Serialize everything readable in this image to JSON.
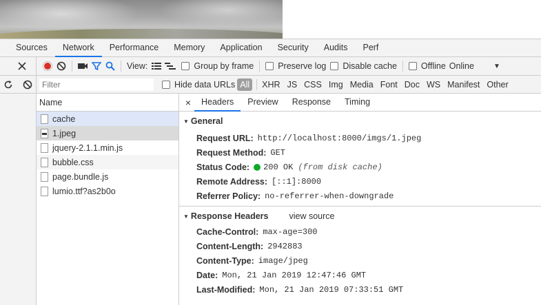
{
  "tabs": [
    {
      "label": "Sources"
    },
    {
      "label": "Network"
    },
    {
      "label": "Performance"
    },
    {
      "label": "Memory"
    },
    {
      "label": "Application"
    },
    {
      "label": "Security"
    },
    {
      "label": "Audits"
    },
    {
      "label": "Perf"
    }
  ],
  "toolbar": {
    "view_label": "View:",
    "group_by_frame": "Group by frame",
    "preserve_log": "Preserve log",
    "disable_cache": "Disable cache",
    "offline": "Offline",
    "throttle_value": "Online"
  },
  "filter": {
    "placeholder": "Filter",
    "hide_data_urls": "Hide data URLs",
    "types": [
      "All",
      "XHR",
      "JS",
      "CSS",
      "Img",
      "Media",
      "Font",
      "Doc",
      "WS",
      "Manifest",
      "Other"
    ]
  },
  "requests": {
    "column_name": "Name",
    "items": [
      {
        "name": "cache"
      },
      {
        "name": "1.jpeg"
      },
      {
        "name": "jquery-2.1.1.min.js"
      },
      {
        "name": "bubble.css"
      },
      {
        "name": "page.bundle.js"
      },
      {
        "name": "lumio.ttf?as2b0o"
      }
    ]
  },
  "details": {
    "tabs": [
      "Headers",
      "Preview",
      "Response",
      "Timing"
    ],
    "general": {
      "title": "General",
      "request_url_label": "Request URL:",
      "request_url": "http://localhost:8000/imgs/1.jpeg",
      "request_method_label": "Request Method:",
      "request_method": "GET",
      "status_code_label": "Status Code:",
      "status_code": "200 OK",
      "status_note": "(from disk cache)",
      "remote_address_label": "Remote Address:",
      "remote_address": "[::1]:8000",
      "referrer_policy_label": "Referrer Policy:",
      "referrer_policy": "no-referrer-when-downgrade"
    },
    "response_headers": {
      "title": "Response Headers",
      "view_source": "view source",
      "items": [
        {
          "key": "Cache-Control:",
          "value": "max-age=300"
        },
        {
          "key": "Content-Length:",
          "value": "2942883"
        },
        {
          "key": "Content-Type:",
          "value": "image/jpeg"
        },
        {
          "key": "Date:",
          "value": "Mon, 21 Jan 2019 12:47:46 GMT"
        },
        {
          "key": "Last-Modified:",
          "value": "Mon, 21 Jan 2019 07:33:51 GMT"
        }
      ]
    }
  },
  "colors": {
    "accent": "#1a73e8",
    "record": "#d93025",
    "status_ok": "#0eaa27"
  }
}
